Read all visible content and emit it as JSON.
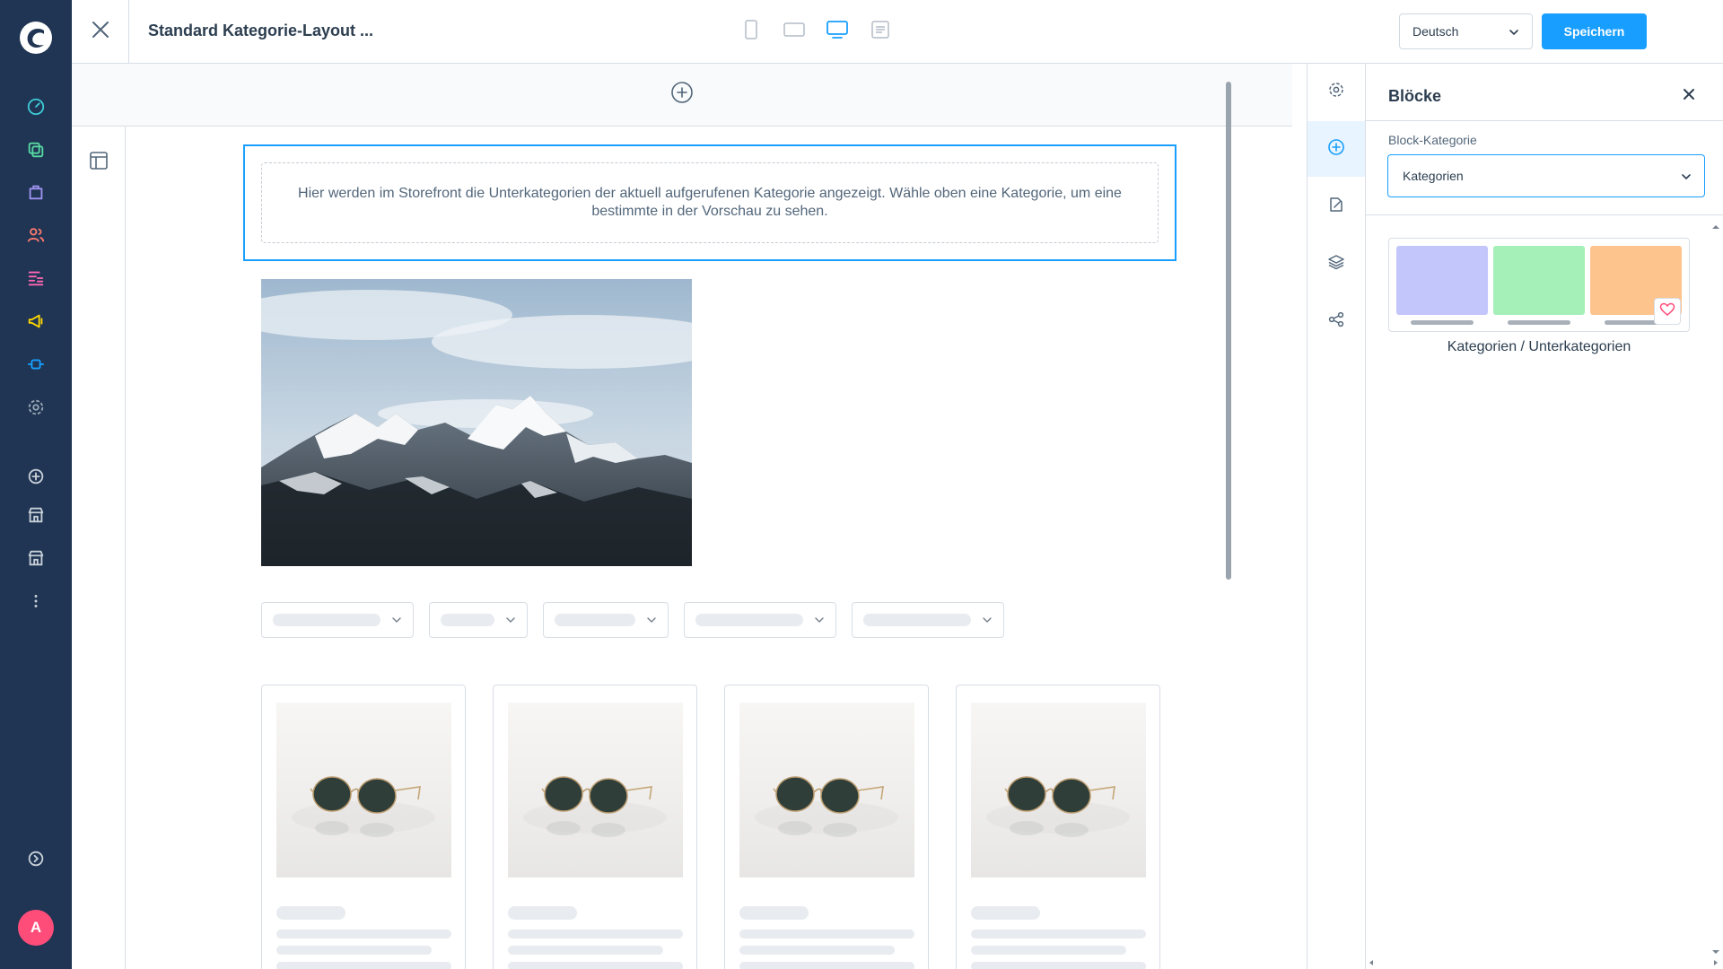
{
  "app": {
    "title": "Standard Kategorie-Layout ...",
    "avatar_initial": "A",
    "accent_color": "#189eff",
    "nav_background": "#1f3553"
  },
  "nav": {
    "items": [
      {
        "icon": "dashboard-icon",
        "color": "#3ec9d6"
      },
      {
        "icon": "catalog-icon",
        "color": "#57d9a3"
      },
      {
        "icon": "orders-icon",
        "color": "#a092f0"
      },
      {
        "icon": "customers-icon",
        "color": "#ff7a6e"
      },
      {
        "icon": "content-icon",
        "color": "#ff68b4"
      },
      {
        "icon": "marketing-icon",
        "color": "#ffd700"
      },
      {
        "icon": "extensions-icon",
        "color": "#189eff"
      },
      {
        "icon": "settings-icon",
        "color": "#9aa8b5"
      },
      {
        "icon": "add-circle-icon",
        "color": "#c8d0d8"
      },
      {
        "icon": "storefront-icon",
        "color": "#c8d0d8"
      },
      {
        "icon": "storefront-icon",
        "color": "#c8d0d8"
      },
      {
        "icon": "more-vertical-icon",
        "color": "#c8d0d8"
      },
      {
        "icon": "collapse-menu-icon",
        "color": "#c8d0d8"
      }
    ]
  },
  "toolbar": {
    "language": "Deutsch",
    "save_label": "Speichern",
    "device_views": [
      "mobile",
      "tablet",
      "desktop",
      "form"
    ],
    "active_device": "desktop"
  },
  "canvas": {
    "category_block_text": "Hier werden im Storefront die Unterkategorien der aktuell aufgerufenen Kategorie angezeigt. Wähle oben eine Kategorie, um eine bestimmte in der Vorschau zu sehen.",
    "filter_count": 5,
    "product_count": 4
  },
  "panel": {
    "title": "Blöcke",
    "field_label": "Block-Kategorie",
    "selected_category": "Kategorien",
    "block_name": "Kategorien / Unterkategorien",
    "preview_colors": [
      "#c3c6fb",
      "#a4f0b8",
      "#fdc48e"
    ]
  }
}
